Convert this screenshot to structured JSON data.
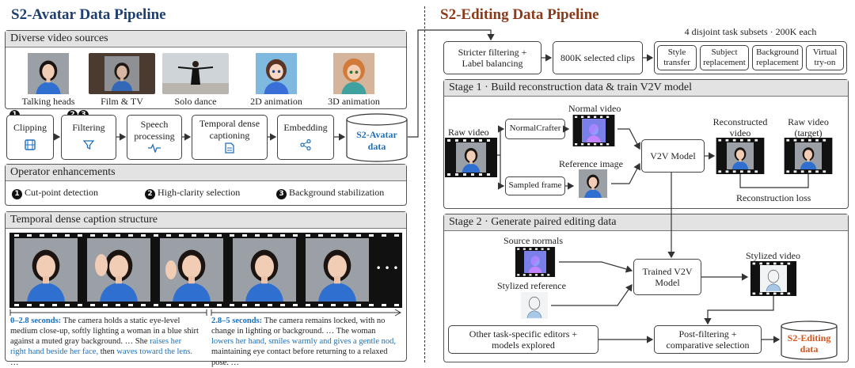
{
  "left": {
    "title": "S2-Avatar Data Pipeline",
    "sources": {
      "header": "Diverse video sources",
      "items": [
        "Talking heads",
        "Film & TV",
        "Solo dance",
        "2D animation",
        "3D animation"
      ]
    },
    "operators": {
      "badges": [
        "1",
        "2",
        "3"
      ],
      "steps": [
        "Clipping",
        "Filtering",
        "Speech processing",
        "Temporal dense captioning",
        "Embedding"
      ],
      "output": "S2-Avatar data"
    },
    "enhancements": {
      "header": "Operator enhancements",
      "items": [
        {
          "num": "1",
          "label": "Cut-point detection"
        },
        {
          "num": "2",
          "label": "High-clarity selection"
        },
        {
          "num": "3",
          "label": "Background stabilization"
        }
      ]
    },
    "caption_structure": {
      "header": "Temporal dense caption structure",
      "ellipsis": "• • •",
      "c1": {
        "time": "0–2.8 seconds:",
        "t1": " The camera holds a static eye-level medium close-up, softly lighting a woman in a blue shirt against a muted gray background. … She ",
        "h1": "raises her right hand beside her face,",
        "t2": " then ",
        "h2": "waves toward the lens.",
        "t3": " …"
      },
      "c2": {
        "time": "2.8–5 seconds:",
        "t1": " The camera remains locked, with no change in lighting or background. … The woman ",
        "h1": "lowers her hand, smiles warmly and gives a gentle nod,",
        "t2": " maintaining eye contact before returning to a relaxed pose. …"
      }
    }
  },
  "right": {
    "title": "S2-Editing Data Pipeline",
    "top": {
      "filter": "Stricter filtering + Label balancing",
      "clips": "800K selected clips",
      "subsets_label": "4 disjoint task subsets · 200K each",
      "subsets": [
        "Style transfer",
        "Subject replacement",
        "Background replacement",
        "Virtual try-on"
      ]
    },
    "stage1": {
      "header": "Stage 1 · Build reconstruction data & train V2V model",
      "raw_video": "Raw video",
      "normalcrafter": "NormalCrafter",
      "normal_video": "Normal video",
      "sampled_frame": "Sampled frame",
      "reference_image": "Reference image",
      "model": "V2V Model",
      "reconstructed": "Reconstructed video",
      "raw_target": "Raw video (target)",
      "loss": "Reconstruction loss"
    },
    "stage2": {
      "header": "Stage 2 · Generate paired editing data",
      "source_normals": "Source normals",
      "stylized_reference": "Stylized reference",
      "model": "Trained V2V Model",
      "stylized_video": "Stylized video",
      "editors": "Other task-specific editors + models explored",
      "postfilter": "Post-filtering + comparative selection",
      "output": "S2-Editing data"
    }
  },
  "colors": {
    "left_title": "#1f3f6e",
    "right_title": "#8b3a1a",
    "accent_blue": "#1e6fb8",
    "accent_orange": "#d4561e"
  }
}
